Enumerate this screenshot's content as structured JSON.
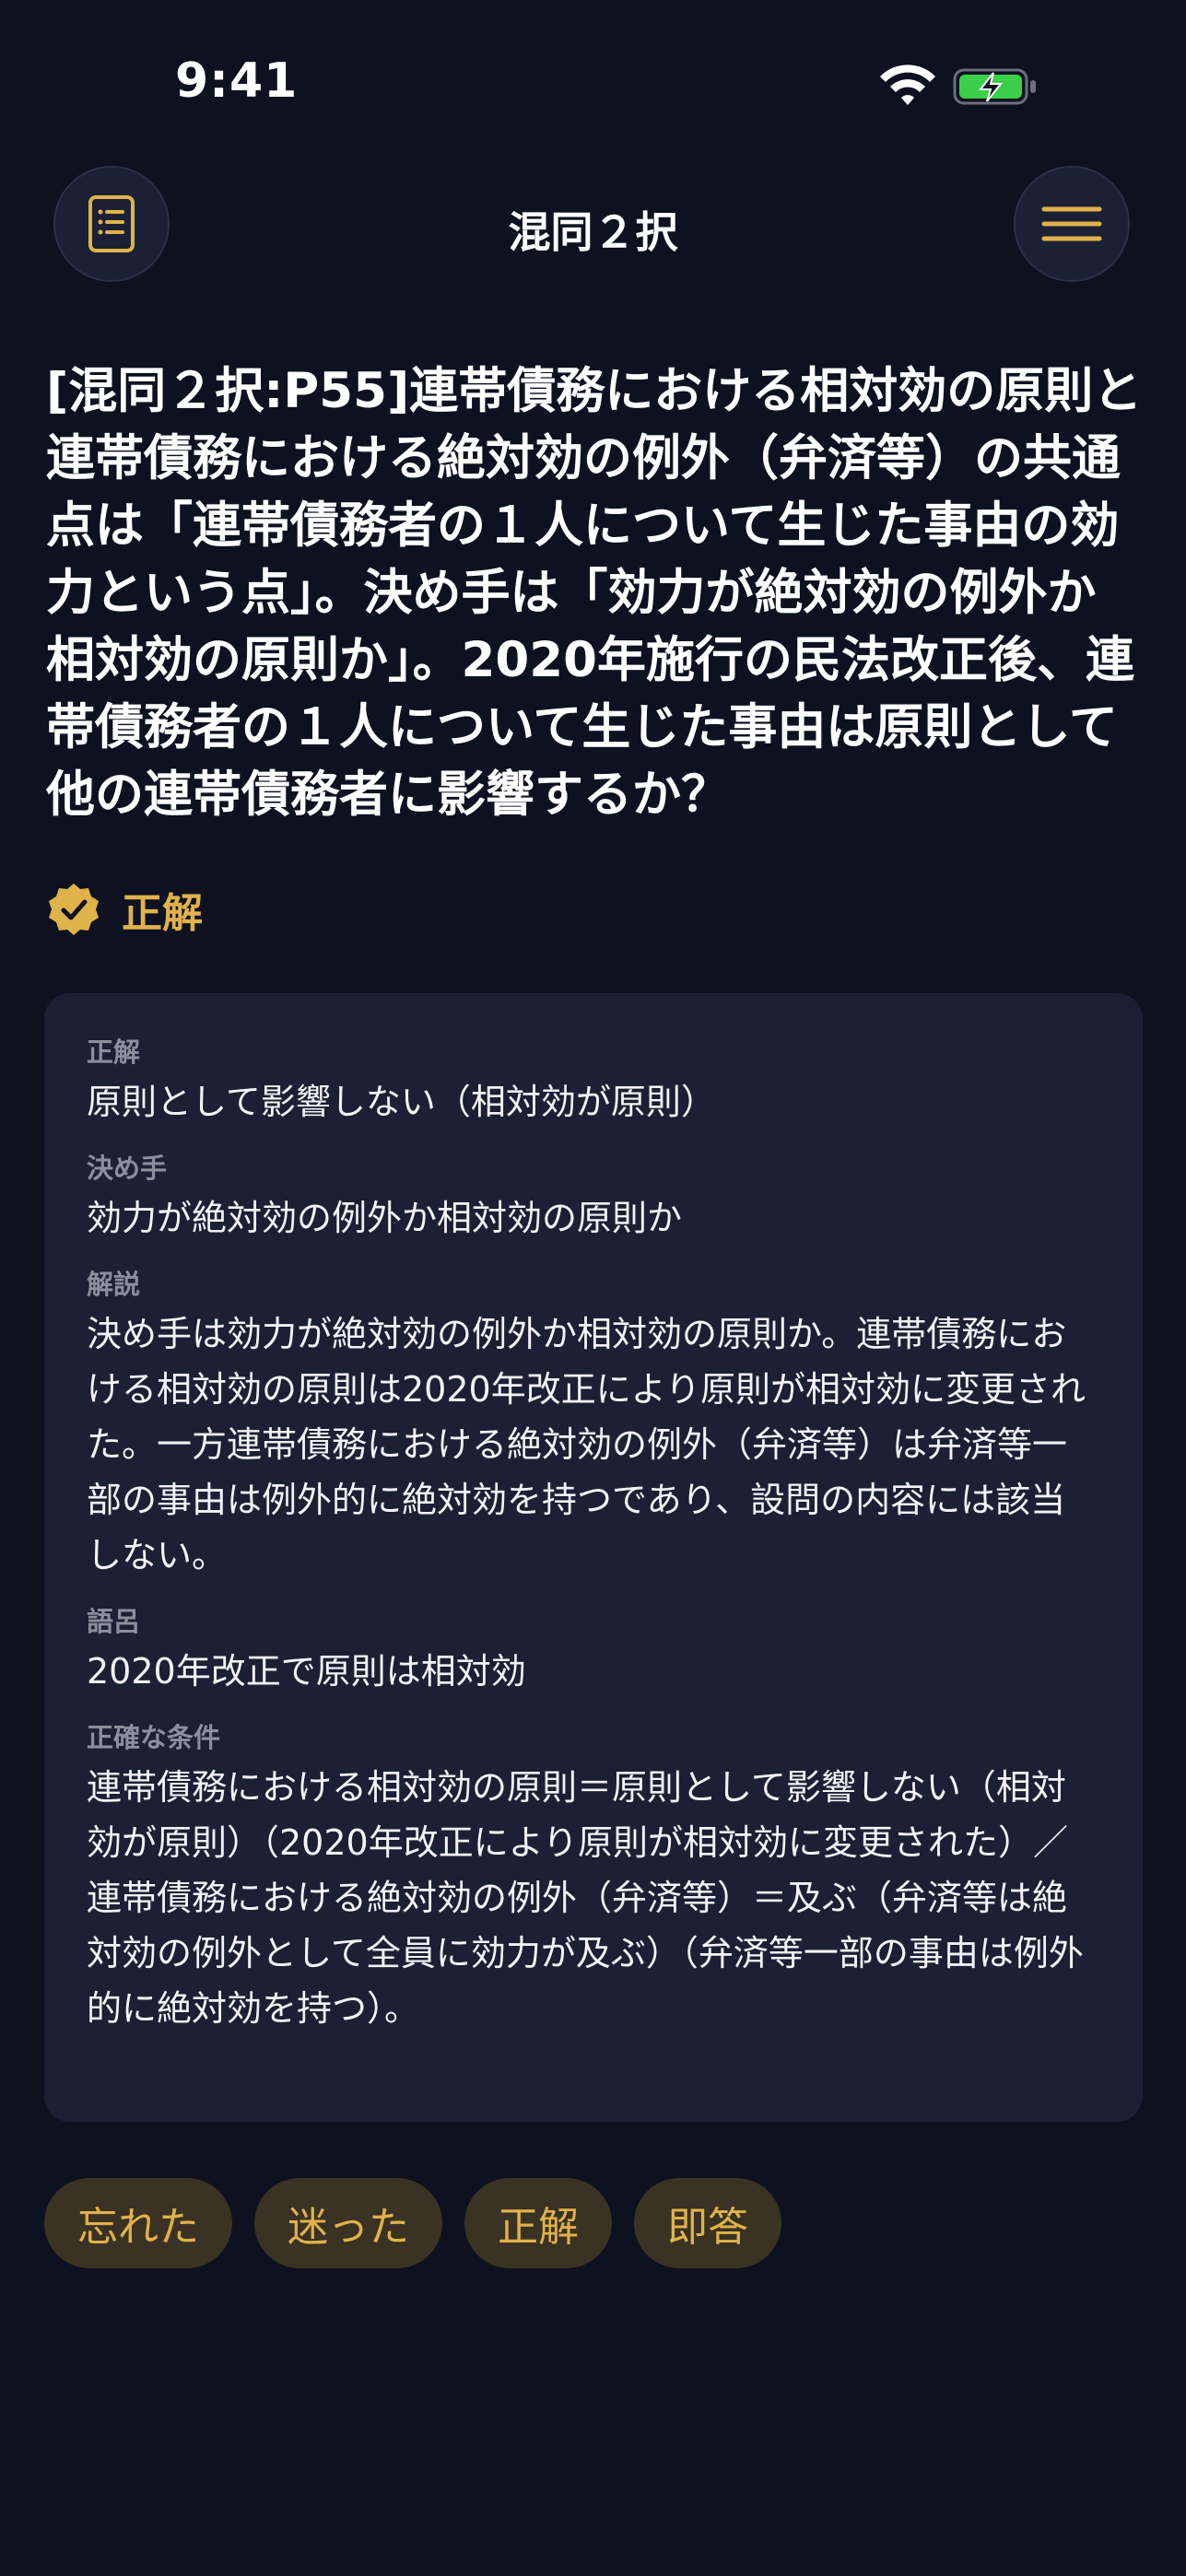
{
  "status_bar": {
    "time": "9:41"
  },
  "header": {
    "title": "混同２択"
  },
  "question": {
    "text": "[混同２択:P55]連帯債務における相対効の原則と連帯債務における絶対効の例外（弁済等）の共通点は「連帯債務者の１人について生じた事由の効力という点」。決め手は「効力が絶対効の例外か相対効の原則か」。2020年施行の民法改正後、連帯債務者の１人について生じた事由は原則として他の連帯債務者に影響するか？"
  },
  "result": {
    "label": "正解",
    "accent": "#e0b24a"
  },
  "card": {
    "sections": [
      {
        "label": "正解",
        "value": "原則として影響しない（相対効が原則）"
      },
      {
        "label": "決め手",
        "value": "効力が絶対効の例外か相対効の原則か"
      },
      {
        "label": "解説",
        "value": "決め手は効力が絶対効の例外か相対効の原則か。連帯債務における相対効の原則は2020年改正により原則が相対効に変更された。一方連帯債務における絶対効の例外（弁済等）は弁済等一部の事由は例外的に絶対効を持つであり、設問の内容には該当しない。"
      },
      {
        "label": "語呂",
        "value": "2020年改正で原則は相対効"
      },
      {
        "label": "正確な条件",
        "value": "連帯債務における相対効の原則＝原則として影響しない（相対効が原則）（2020年改正により原則が相対効に変更された）／連帯債務における絶対効の例外（弁済等）＝及ぶ（弁済等は絶対効の例外として全員に効力が及ぶ）（弁済等一部の事由は例外的に絶対効を持つ）。"
      }
    ]
  },
  "actions": [
    {
      "label": "忘れた"
    },
    {
      "label": "迷った"
    },
    {
      "label": "正解"
    },
    {
      "label": "即答"
    }
  ],
  "icons": {
    "left": "notebook-icon",
    "right": "menu-icon",
    "result": "verified-check-icon"
  }
}
